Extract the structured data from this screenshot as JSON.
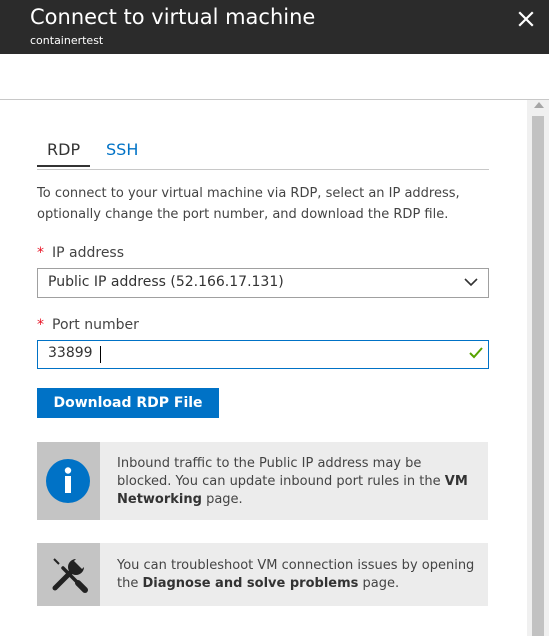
{
  "header": {
    "title": "Connect to virtual machine",
    "subtitle": "containertest"
  },
  "tabs": [
    {
      "label": "RDP",
      "active": true
    },
    {
      "label": "SSH",
      "active": false
    }
  ],
  "description": "To connect to your virtual machine via RDP, select an IP address, optionally change the port number, and download the RDP file.",
  "ip_address": {
    "label": "IP address",
    "required_mark": "*",
    "selected": "Public IP address (52.166.17.131)"
  },
  "port_number": {
    "label": "Port number",
    "required_mark": "*",
    "value": "33899"
  },
  "download_button": "Download RDP File",
  "notices": [
    {
      "icon": "info-icon",
      "text_before": "Inbound traffic to the Public IP address may be blocked. You can update inbound port rules in the ",
      "bold": "VM Networking",
      "text_after": " page."
    },
    {
      "icon": "tools-icon",
      "text_before": "You can troubleshoot VM connection issues by opening the ",
      "bold": "Diagnose and solve problems",
      "text_after": " page."
    }
  ],
  "colors": {
    "header_bg": "#2b2b2b",
    "accent": "#0072c6",
    "required": "#e81123",
    "valid": "#57a300"
  }
}
